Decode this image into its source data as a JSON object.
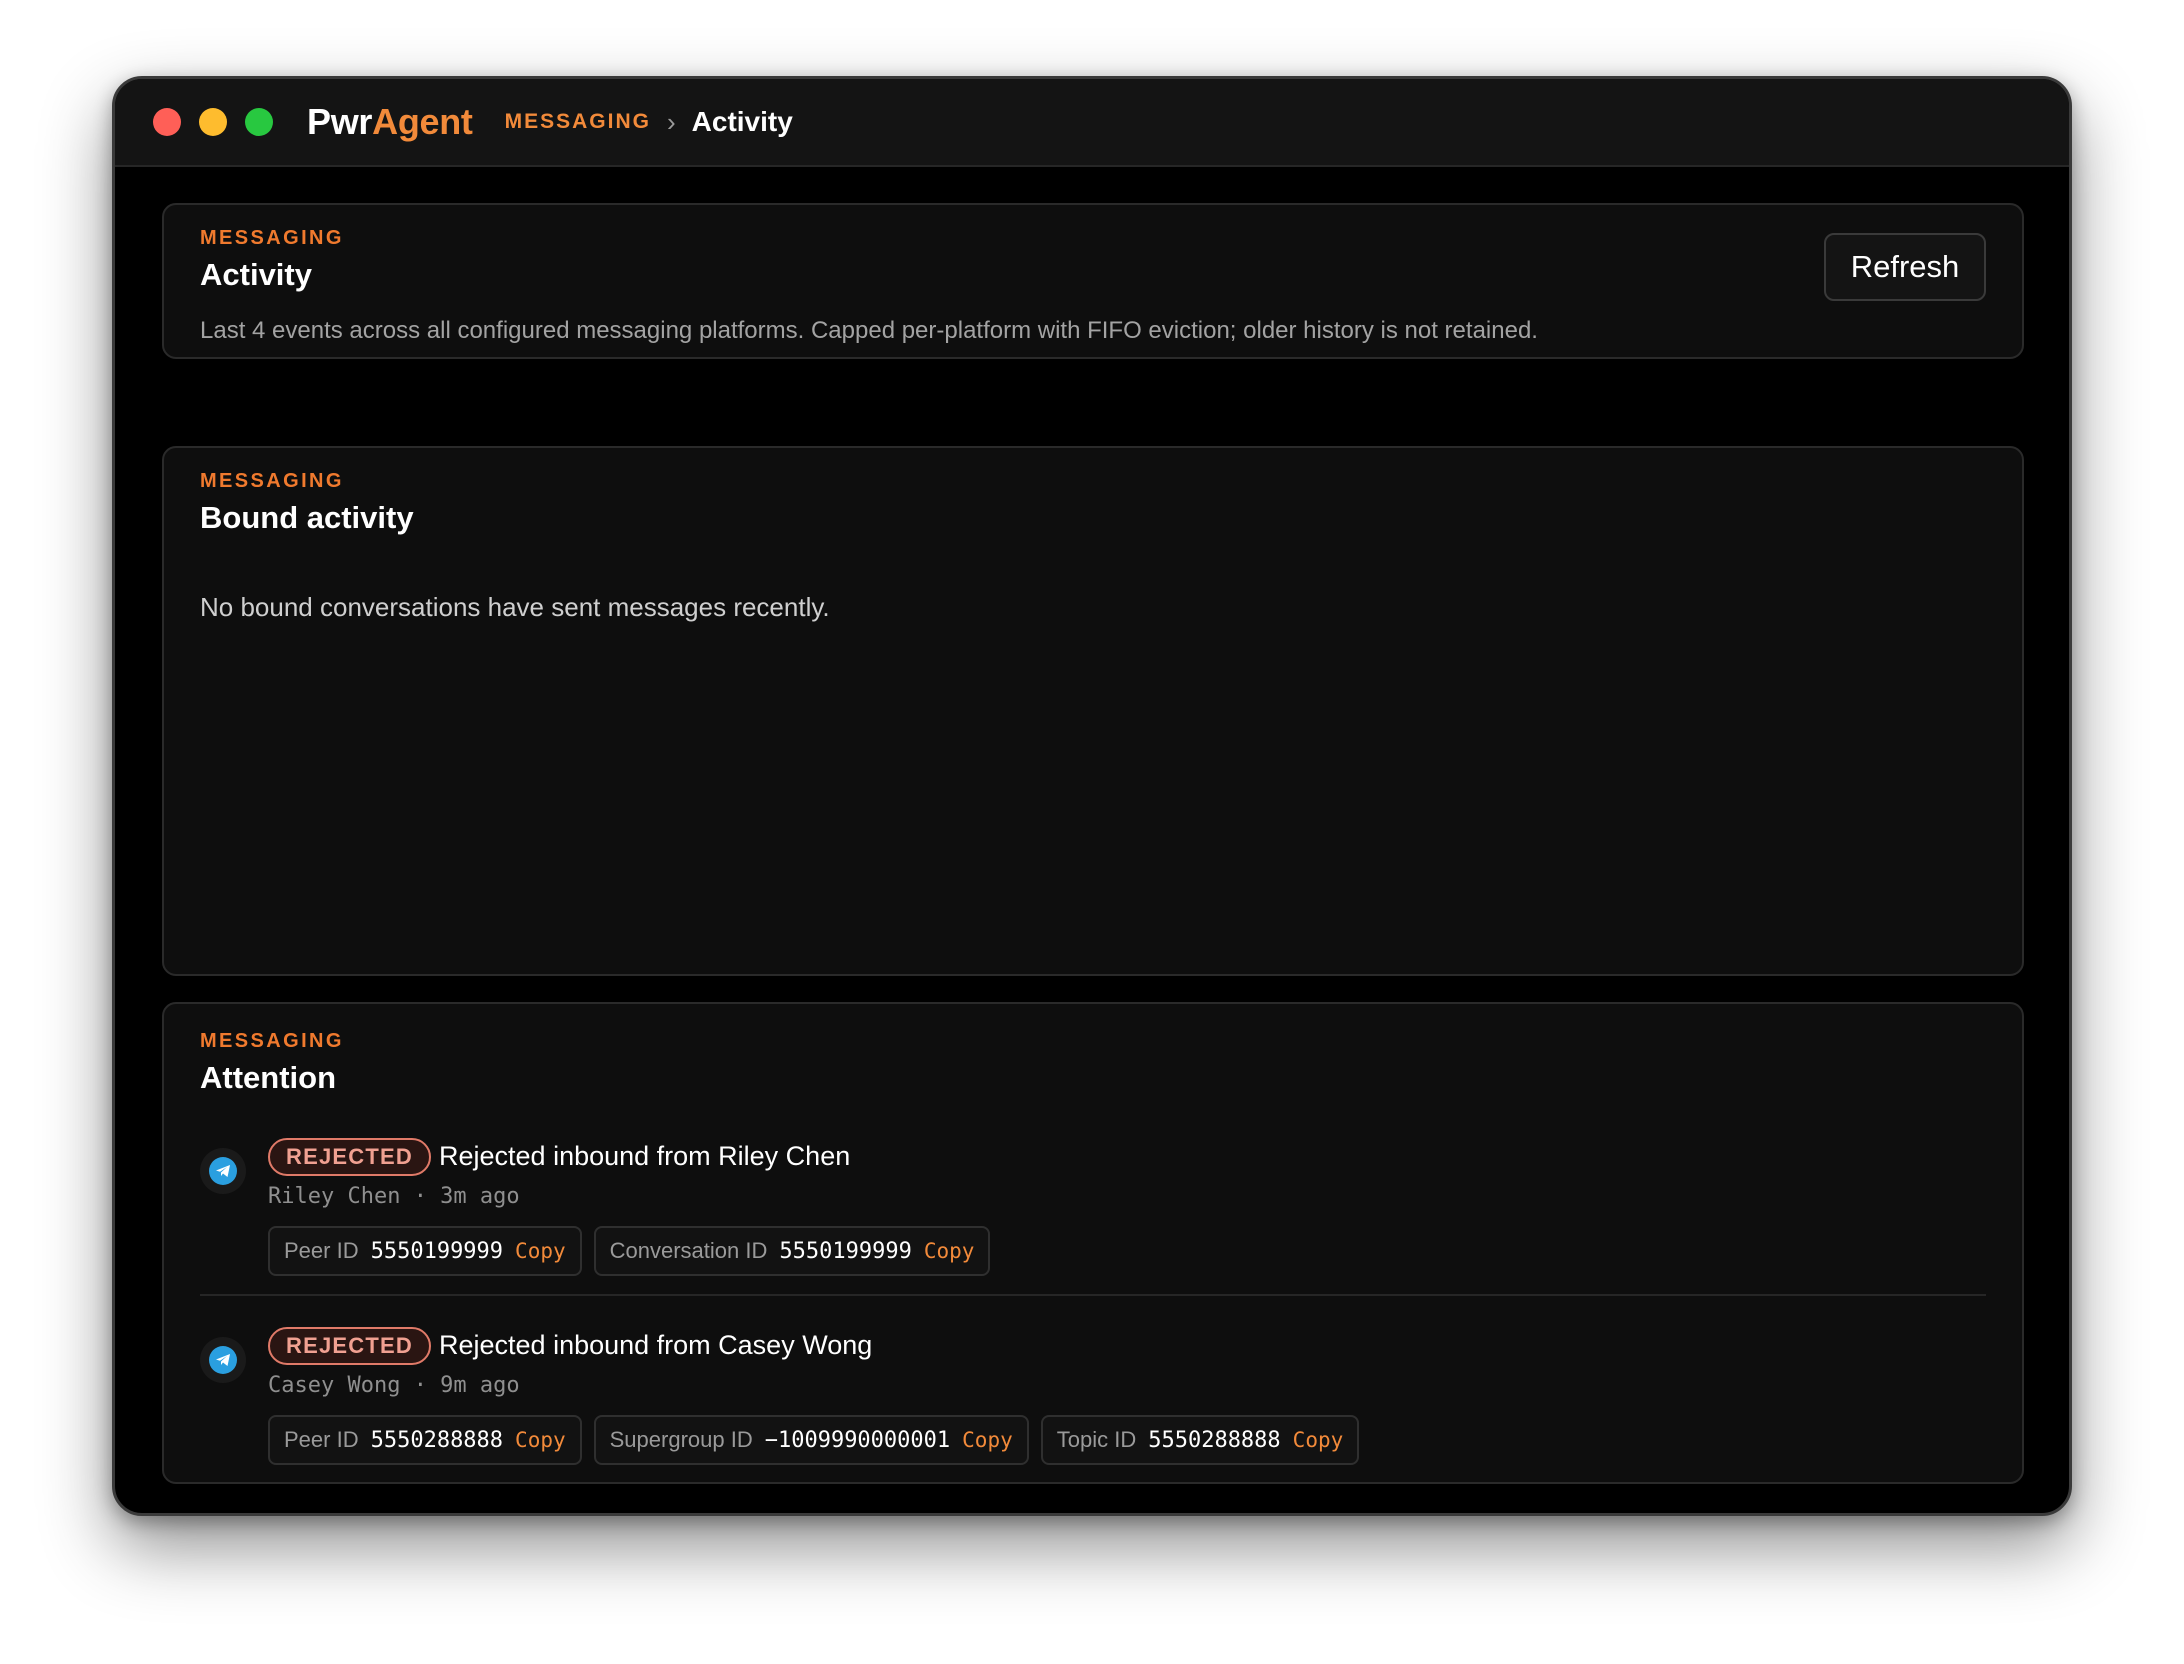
{
  "app": {
    "brand_prefix": "Pwr",
    "brand_accent": "Agent",
    "breadcrumb_section": "MESSAGING",
    "breadcrumb_sep": "›",
    "breadcrumb_current": "Activity"
  },
  "activity_card": {
    "eyebrow": "MESSAGING",
    "title": "Activity",
    "refresh_label": "Refresh",
    "description": "Last 4 events across all configured messaging platforms. Capped per-platform with FIFO eviction; older history is not retained."
  },
  "bound_card": {
    "eyebrow": "MESSAGING",
    "title": "Bound activity",
    "empty_text": "No bound conversations have sent messages recently."
  },
  "attention_card": {
    "eyebrow": "MESSAGING",
    "title": "Attention",
    "events": [
      {
        "icon": "telegram-icon",
        "badge": "REJECTED",
        "title": "Rejected inbound from Riley Chen",
        "meta": "Riley Chen · 3m ago",
        "chips": [
          {
            "label": "Peer ID",
            "value": "5550199999",
            "action": "Copy"
          },
          {
            "label": "Conversation ID",
            "value": "5550199999",
            "action": "Copy"
          }
        ]
      },
      {
        "icon": "telegram-icon",
        "badge": "REJECTED",
        "title": "Rejected inbound from Casey Wong",
        "meta": "Casey Wong · 9m ago",
        "chips": [
          {
            "label": "Peer ID",
            "value": "5550288888",
            "action": "Copy"
          },
          {
            "label": "Supergroup ID",
            "value": "−1009990000001",
            "action": "Copy"
          },
          {
            "label": "Topic ID",
            "value": "5550288888",
            "action": "Copy"
          }
        ]
      }
    ]
  },
  "colors": {
    "accent": "#f28a3a",
    "badge_rejected": "#e07a68",
    "telegram": "#2a9fe0",
    "window_bg": "#000000",
    "card_bg": "#0e0e0e"
  }
}
